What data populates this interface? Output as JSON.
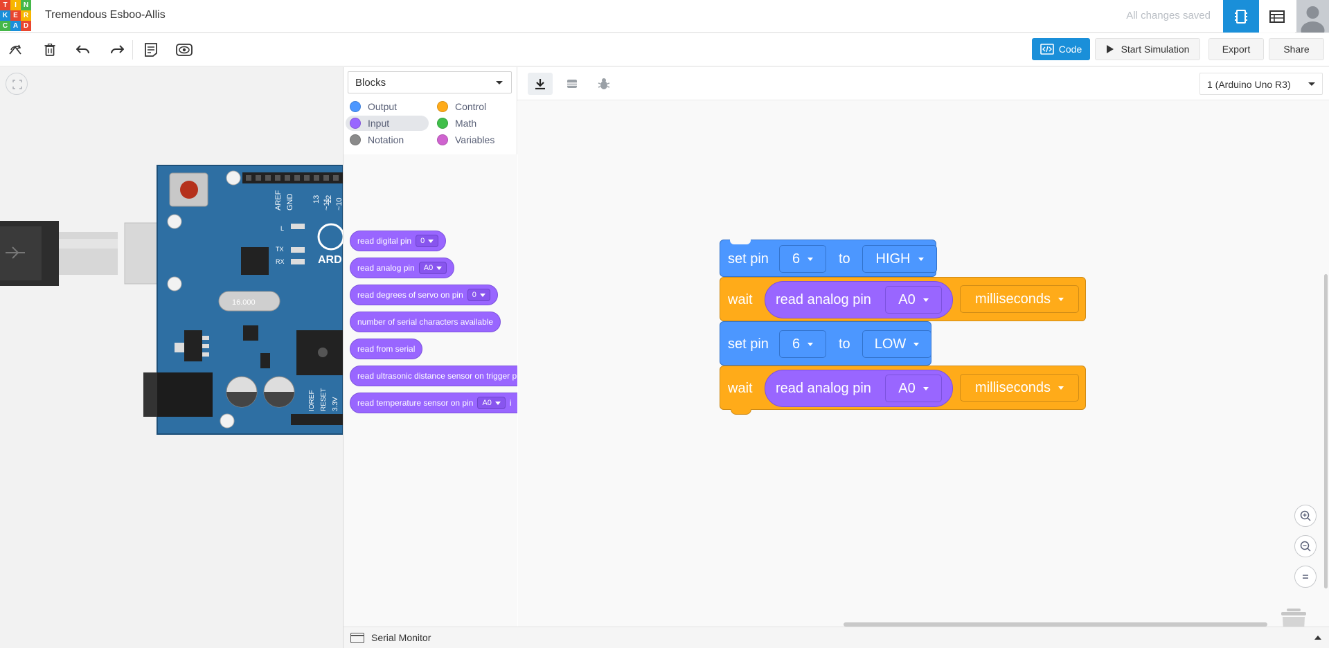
{
  "app": {
    "logo_letters": [
      "T",
      "I",
      "N",
      "K",
      "E",
      "R",
      "C",
      "A",
      "D"
    ],
    "logo_colors": [
      "#e8462f",
      "#f7b500",
      "#45b749",
      "#1a8fd9",
      "#e8462f",
      "#f7b500",
      "#45b749",
      "#1a8fd9",
      "#e8462f"
    ],
    "project_title": "Tremendous Esboo-Allis",
    "save_status": "All changes saved",
    "accent": "#1a8fd9"
  },
  "toolbar": {
    "tools": [
      "rotate-icon",
      "trash-icon",
      "undo-icon",
      "redo-icon",
      "notes-icon",
      "visibility-icon"
    ],
    "code_label": "Code",
    "sim_label": "Start Simulation",
    "export_label": "Export",
    "share_label": "Share"
  },
  "board": {
    "header_labels": [
      "AREF",
      "GND",
      "13",
      "12",
      "~11",
      "~10"
    ],
    "side_labels": [
      "L",
      "TX",
      "RX"
    ],
    "power_labels": [
      "IOREF",
      "RESET",
      "3.3V"
    ],
    "crystal_label": "16.000",
    "brand_partial": "ARD"
  },
  "palette": {
    "mode": "Blocks",
    "categories": [
      {
        "label": "Output",
        "color": "#4c97ff"
      },
      {
        "label": "Control",
        "color": "#ffab19"
      },
      {
        "label": "Input",
        "color": "#9966ff",
        "selected": true
      },
      {
        "label": "Math",
        "color": "#40bf4a"
      },
      {
        "label": "Notation",
        "color": "#8a8a8a"
      },
      {
        "label": "Variables",
        "color": "#cf63cf"
      }
    ],
    "blocks": [
      {
        "text": "read digital pin",
        "value": "0"
      },
      {
        "text": "read analog pin",
        "value": "A0"
      },
      {
        "text": "read degrees of servo on pin",
        "value": "0"
      },
      {
        "text": "number of serial characters available"
      },
      {
        "text": "read from serial"
      },
      {
        "text": "read ultrasonic distance sensor on trigger pi"
      },
      {
        "text": "read temperature sensor on pin",
        "value": "A0",
        "suffix": "i"
      }
    ]
  },
  "workspace": {
    "device": "1 (Arduino Uno R3)",
    "program": [
      {
        "kind": "set",
        "label": "set pin",
        "pin": "6",
        "to": "to",
        "value": "HIGH"
      },
      {
        "kind": "wait",
        "label": "wait",
        "reporter": "read analog pin",
        "reporter_value": "A0",
        "unit": "milliseconds"
      },
      {
        "kind": "set",
        "label": "set pin",
        "pin": "6",
        "to": "to",
        "value": "LOW"
      },
      {
        "kind": "wait",
        "label": "wait",
        "reporter": "read analog pin",
        "reporter_value": "A0",
        "unit": "milliseconds"
      }
    ]
  },
  "serial": {
    "label": "Serial Monitor"
  }
}
